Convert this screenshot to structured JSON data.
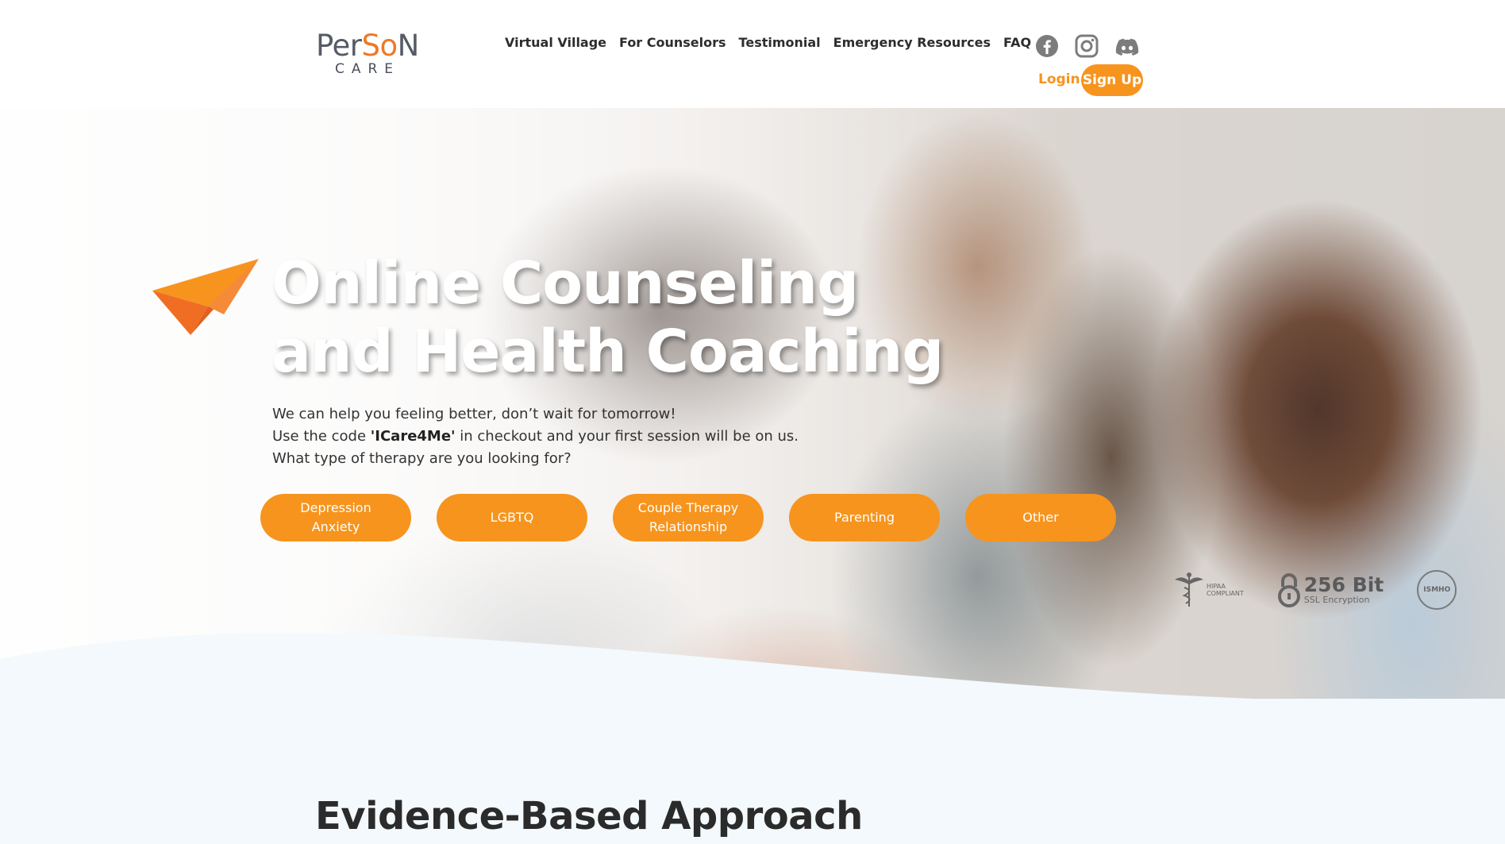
{
  "brand": {
    "logo_top_a": "Per",
    "logo_top_b": "So",
    "logo_top_c": "N",
    "logo_bottom": "CARE",
    "accent": "#f7941d",
    "logo_orange": "#ee7a26"
  },
  "nav": {
    "items": [
      "Virtual Village",
      "For Counselors",
      "Testimonial",
      "Emergency Resources",
      "FAQ"
    ]
  },
  "social": {
    "icons": [
      "facebook-icon",
      "instagram-icon",
      "discord-icon"
    ]
  },
  "auth": {
    "login": "Login",
    "signup": "Sign Up"
  },
  "hero": {
    "title_line1": "Online Counseling",
    "title_line2": "and Health Coaching",
    "line1": "We can help you feeling better, don’t wait for tomorrow!",
    "line2_pre": "Use the code ",
    "line2_code": "'ICare4Me'",
    "line2_post": " in checkout and your first session will be on us.",
    "line3": "What type of therapy are you looking for?"
  },
  "therapy_options": [
    {
      "label_line1": "Depression",
      "label_line2": "Anxiety"
    },
    {
      "label_line1": "LGBTQ",
      "label_line2": ""
    },
    {
      "label_line1": "Couple Therapy",
      "label_line2": "Relationship"
    },
    {
      "label_line1": "Parenting",
      "label_line2": ""
    },
    {
      "label_line1": "Other",
      "label_line2": ""
    }
  ],
  "badges": {
    "hipaa_line1": "HIPAA",
    "hipaa_line2": "COMPLIANT",
    "ssl_big": "256 Bit",
    "ssl_small": "SSL Encryption",
    "ismho": "ISMHO"
  },
  "section": {
    "title": "Evidence-Based Approach"
  }
}
